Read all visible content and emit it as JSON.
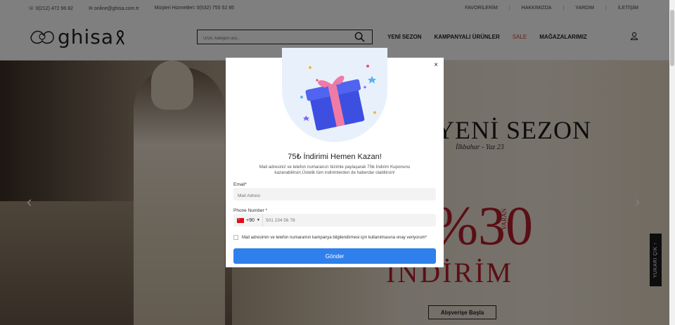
{
  "topbar": {
    "phone": "☏ 0(212) 472 96 82",
    "email": "✉ online@ghisa.com.tr",
    "whatsapp": "Müşteri Hizmetleri: 0(532) 755 52 85",
    "links": [
      "FAVORİLERİM",
      "HAKKIMIZDA",
      "YARDIM",
      "İLETİŞİM"
    ]
  },
  "header": {
    "logo_text": "ghisa",
    "search_placeholder": "Ürün, kategori ara...",
    "nav": [
      "YENİ SEZON",
      "KAMPANYALI ÜRÜNLER",
      "SALE",
      "MAĞAZALARIMIZ"
    ]
  },
  "hero": {
    "title": "YENİ SEZON",
    "subtitle": "İlkbahar - Yaz 23",
    "percent": "%30",
    "vertical_text": "VARAN",
    "discount": "İNDİRİM",
    "cta": "Alışverişe Başla",
    "scroll_top": "YUKARI ÇIK ↑"
  },
  "modal": {
    "close": "×",
    "title": "75₺ İndirimi Hemen Kazan!",
    "desc": "Mail adresiniz ve telefon numaranızı bizimle paylaşarak 75₺ İndirim Kuponunu kazanabilirsin.Üstelik tüm indirimlerden de haberdar olabilirsin!",
    "email_label": "Email*",
    "email_placeholder": "Mail Adresi",
    "phone_label": "Phone Number *",
    "country_code": "+90",
    "phone_placeholder": "501 234 56 78",
    "consent": "Mail adresimin ve telefon numaramın kampanya bilgilendirmesi için kullanılmasına onay veriyorum*",
    "submit": "Gönder"
  },
  "colors": {
    "accent": "#2f80ed",
    "sale": "#d33333",
    "hero_red": "#b41d2a"
  }
}
